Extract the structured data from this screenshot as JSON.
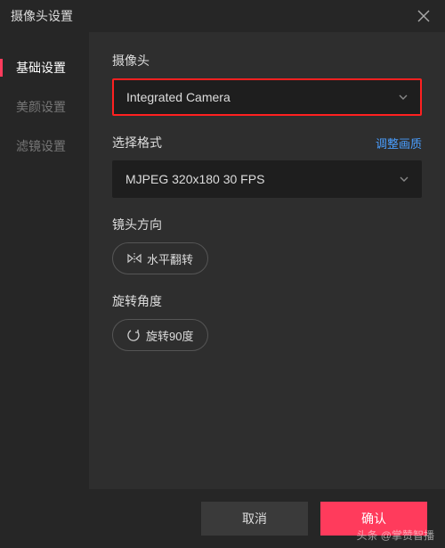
{
  "title": "摄像头设置",
  "sidebar": {
    "items": [
      {
        "label": "基础设置",
        "active": true
      },
      {
        "label": "美颜设置",
        "active": false
      },
      {
        "label": "滤镜设置",
        "active": false
      }
    ]
  },
  "fields": {
    "camera": {
      "label": "摄像头",
      "value": "Integrated Camera"
    },
    "format": {
      "label": "选择格式",
      "link": "调整画质",
      "value": "MJPEG 320x180 30 FPS"
    },
    "mirror": {
      "label": "镜头方向",
      "button": "水平翻转"
    },
    "rotate": {
      "label": "旋转角度",
      "button": "旋转90度"
    }
  },
  "footer": {
    "cancel": "取消",
    "confirm": "确认"
  },
  "watermark": "头条 @掌赞智播"
}
